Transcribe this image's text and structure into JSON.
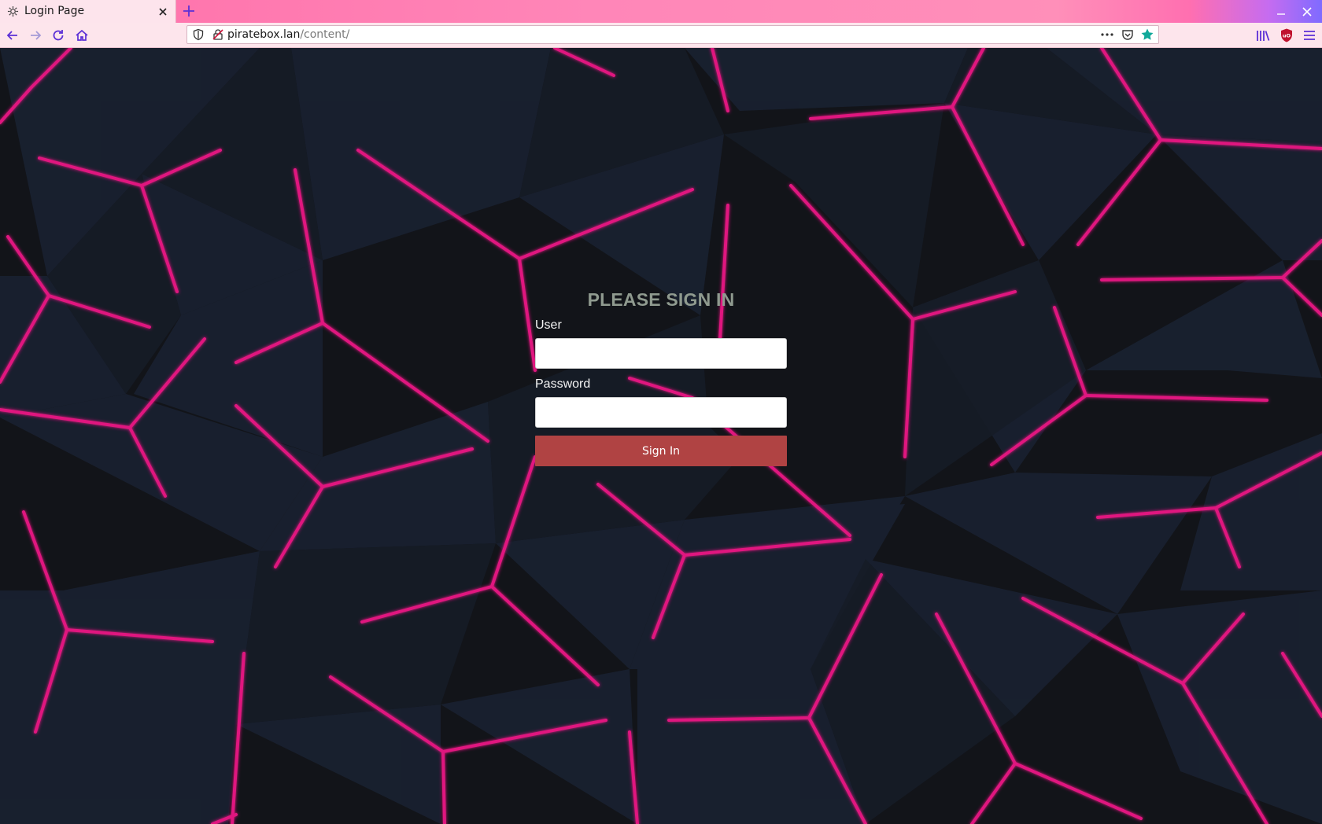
{
  "browser": {
    "tab": {
      "title": "Login Page",
      "favicon": "gear-icon"
    },
    "url": {
      "host": "piratebox.lan",
      "path": "/content/"
    },
    "colors": {
      "tab_strip_accent": "#ff86b8",
      "tab_active_bg": "#fde4ec",
      "navbar_bg": "#fde5ec",
      "icon_color": "#5b2fd6",
      "bookmark_star": "#11a99a",
      "ublock_red": "#c0112e"
    }
  },
  "login": {
    "heading": "PLEASE SIGN IN",
    "user_label": "User",
    "user_value": "",
    "password_label": "Password",
    "password_value": "",
    "submit_label": "Sign In"
  },
  "theme": {
    "background": "#121419",
    "accent_lines": "#e0157f",
    "heading_color": "#8f9a8f",
    "button_color": "#b04343"
  }
}
